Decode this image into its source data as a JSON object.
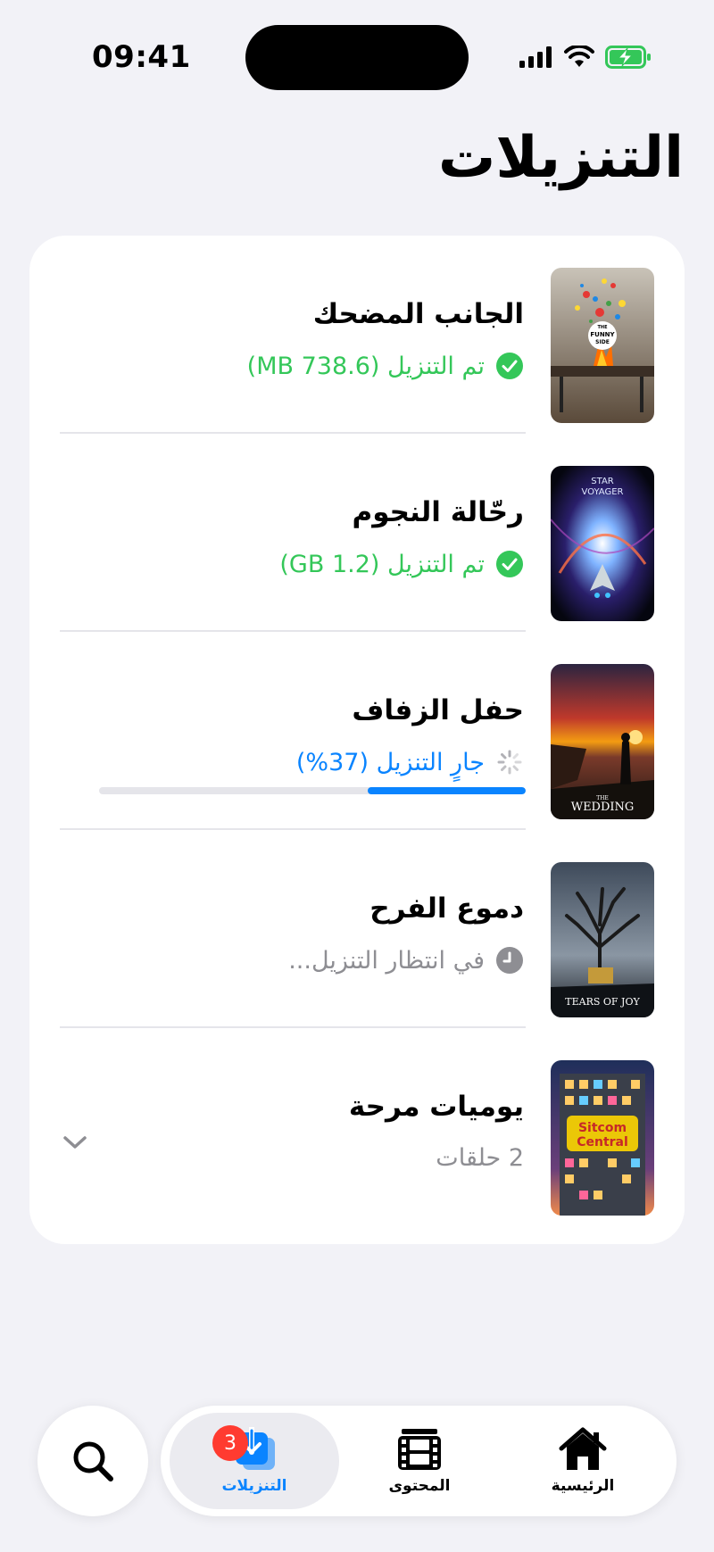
{
  "status_bar": {
    "time": "09:41"
  },
  "header": {
    "title": "التنزيلات"
  },
  "downloads": [
    {
      "title": "الجانب المضحك",
      "status": "تم التنزيل (738.6 MB)",
      "state": "done",
      "poster_text": "THE FUNNY SIDE"
    },
    {
      "title": "رحّالة النجوم",
      "status": "تم التنزيل (1.2 GB)",
      "state": "done",
      "poster_text": "STAR VOYAGER"
    },
    {
      "title": "حفل الزفاف",
      "status": "جارٍ التنزيل (37%)",
      "state": "downloading",
      "progress": 0.37,
      "poster_text": "THE WEDDING"
    },
    {
      "title": "دموع الفرح",
      "status": "في انتظار التنزيل...",
      "state": "waiting",
      "poster_text": "TEARS OF JOY"
    },
    {
      "title": "يوميات مرحة",
      "status": "2 حلقات",
      "state": "series",
      "poster_text": "Sitcom Central"
    }
  ],
  "tabbar": {
    "tabs": [
      {
        "label": "الرئيسية",
        "icon": "home-icon"
      },
      {
        "label": "المحتوى",
        "icon": "film-icon"
      },
      {
        "label": "التنزيلات",
        "icon": "download-icon",
        "active": true,
        "badge": "3"
      }
    ],
    "search_icon": "search-icon"
  },
  "colors": {
    "accent": "#0a84ff",
    "success": "#34c759",
    "badge": "#ff3b30",
    "muted": "#8e8e93"
  }
}
